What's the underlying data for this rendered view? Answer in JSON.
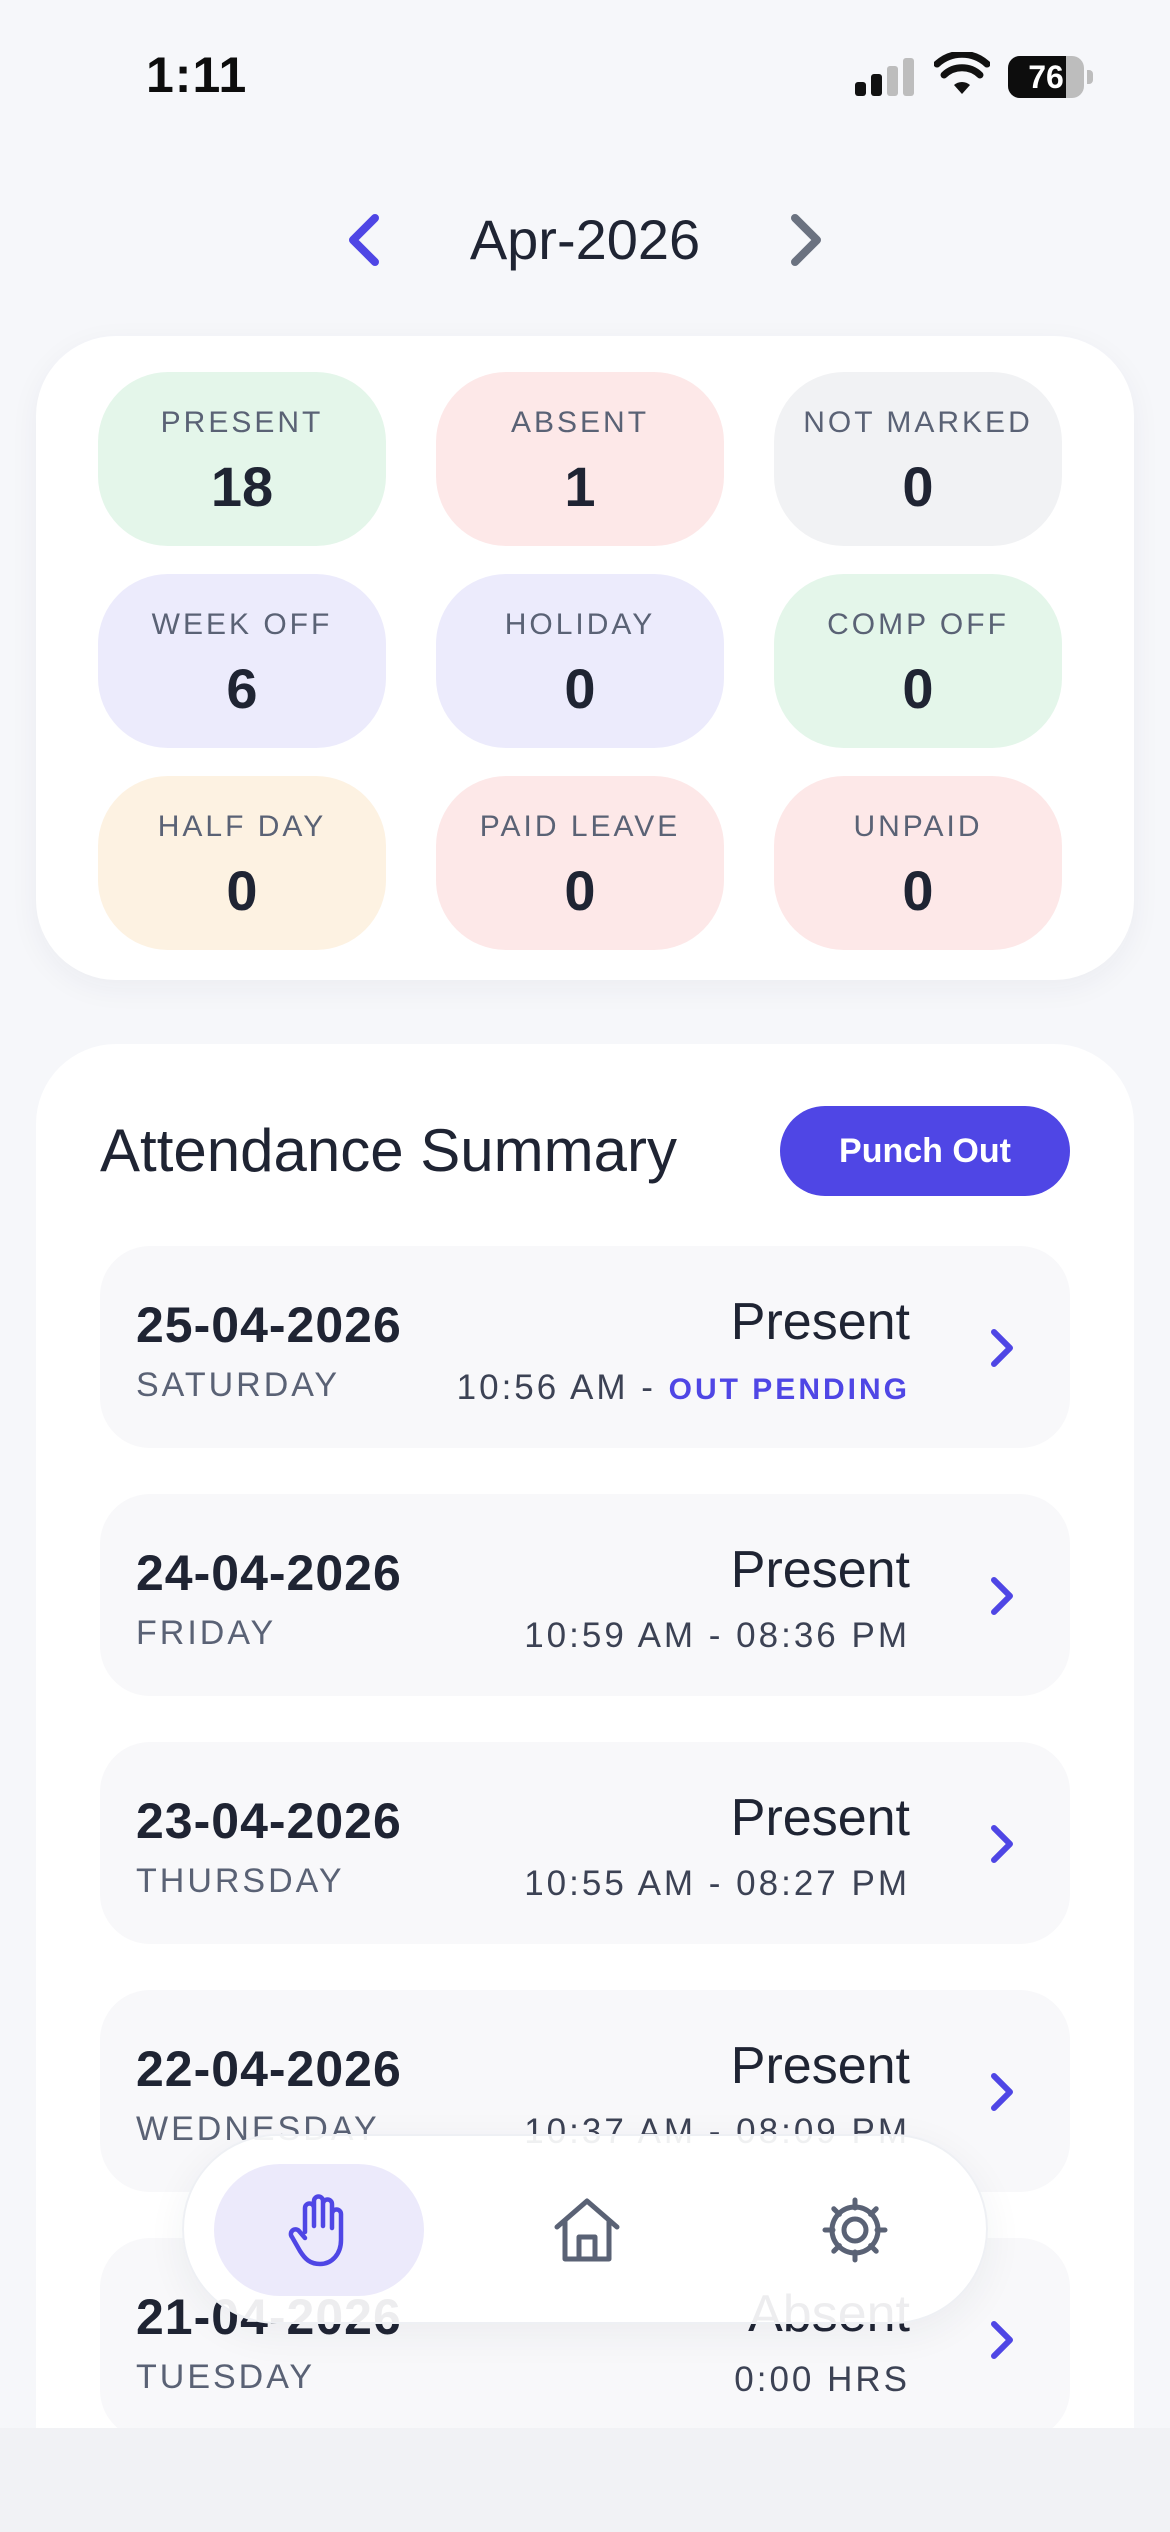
{
  "status_bar": {
    "time": "1:11",
    "battery": "76",
    "battery_level": 0.76,
    "icons": [
      "signal-icon",
      "wifi-icon",
      "battery-icon"
    ]
  },
  "month_nav": {
    "label": "Apr-2026",
    "prev_icon": "chevron-left-icon",
    "next_icon": "chevron-right-icon"
  },
  "stats": [
    {
      "label": "PRESENT",
      "value": "18",
      "color": "#e4f6ea"
    },
    {
      "label": "ABSENT",
      "value": "1",
      "color": "#fde8e8"
    },
    {
      "label": "NOT MARKED",
      "value": "0",
      "color": "#f1f2f4"
    },
    {
      "label": "WEEK OFF",
      "value": "6",
      "color": "#ecebfc"
    },
    {
      "label": "HOLIDAY",
      "value": "0",
      "color": "#ecebfc"
    },
    {
      "label": "COMP OFF",
      "value": "0",
      "color": "#e4f6ea"
    },
    {
      "label": "HALF DAY",
      "value": "0",
      "color": "#fdf2e2"
    },
    {
      "label": "PAID LEAVE",
      "value": "0",
      "color": "#fde8e8"
    },
    {
      "label": "UNPAID",
      "value": "0",
      "color": "#fde8e8"
    }
  ],
  "summary": {
    "title": "Attendance Summary",
    "punch_button": "Punch Out",
    "rows": [
      {
        "date": "25-04-2026",
        "day": "SATURDAY",
        "status": "Present",
        "time": "10:56 AM - ",
        "pending": "OUT PENDING"
      },
      {
        "date": "24-04-2026",
        "day": "FRIDAY",
        "status": "Present",
        "time": "10:59 AM - 08:36 PM",
        "pending": ""
      },
      {
        "date": "23-04-2026",
        "day": "THURSDAY",
        "status": "Present",
        "time": "10:55 AM - 08:27 PM",
        "pending": ""
      },
      {
        "date": "22-04-2026",
        "day": "WEDNESDAY",
        "status": "Present",
        "time": "10:37 AM - 08:09 PM",
        "pending": ""
      },
      {
        "date": "21-04-2026",
        "day": "TUESDAY",
        "status": "Absent",
        "time": "0:00 HRS",
        "pending": ""
      }
    ]
  },
  "bottom_nav": {
    "items": [
      {
        "icon": "hand-icon",
        "active": true
      },
      {
        "icon": "home-icon",
        "active": false
      },
      {
        "icon": "gear-icon",
        "active": false
      }
    ]
  },
  "colors": {
    "accent": "#4f46e5",
    "text": "#1f2433",
    "muted": "#5a6275"
  }
}
